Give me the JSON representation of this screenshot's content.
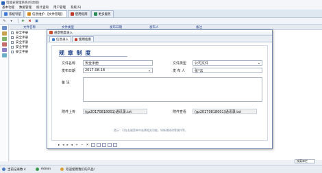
{
  "window": {
    "title": "电能表管理系统(综合版)"
  },
  "menu": [
    "基本功能",
    "数据管理",
    "统计查询",
    "用户管理",
    "系统(S)"
  ],
  "tabs": [
    {
      "label": "系统导航",
      "icon": "navigation-icon",
      "color": "#3d7ad6"
    },
    {
      "label": "信息维护-【文件管理】",
      "icon": "document-icon",
      "color": "#d08a28"
    },
    {
      "label": "使用指南",
      "icon": "help-icon",
      "color": "#c0392b"
    },
    {
      "label": "更多服务",
      "icon": "service-icon",
      "color": "#2e8b57"
    }
  ],
  "grid": {
    "columns": [
      "文件名称",
      "文件类型",
      "发布日期",
      "发布人",
      "备注"
    ],
    "rows": [
      "安全手册",
      "安全手册",
      "安全手册",
      "安全手册",
      "安全手册"
    ]
  },
  "dialog": {
    "title": "规章制度录入",
    "tabs": [
      {
        "label": "信息录入",
        "icon": "edit-icon",
        "color": "#3a79c9"
      },
      {
        "label": "使用指南",
        "icon": "help-icon",
        "color": "#c0392b"
      }
    ],
    "banner": "规 章 制 度",
    "fields": {
      "file_name_label": "文件名称",
      "file_name_value": "安全手册",
      "file_type_label": "文件类型",
      "file_type_value": "公司文件",
      "publish_date_label": "发布日期",
      "publish_date_value": "2017-08-18",
      "publisher_label": "发 布 人",
      "publisher_value": "张*云",
      "remark_label": "备    注",
      "remark_value": "",
      "upload_label": "附件上传",
      "upload_value": "(gz20170818001)通讯录.txt",
      "view_label": "附件查看",
      "view_value": "(gz20170818001)通讯录.txt"
    },
    "hint": "提示：可在右键菜单中选择相关功能，如新增修改等操作等。"
  },
  "bottom": {
    "select_value": "按菜单栏"
  },
  "status": {
    "records": "当前记录数 4",
    "user": "Admin",
    "welcome": "欢迎使用我们的产品!"
  }
}
